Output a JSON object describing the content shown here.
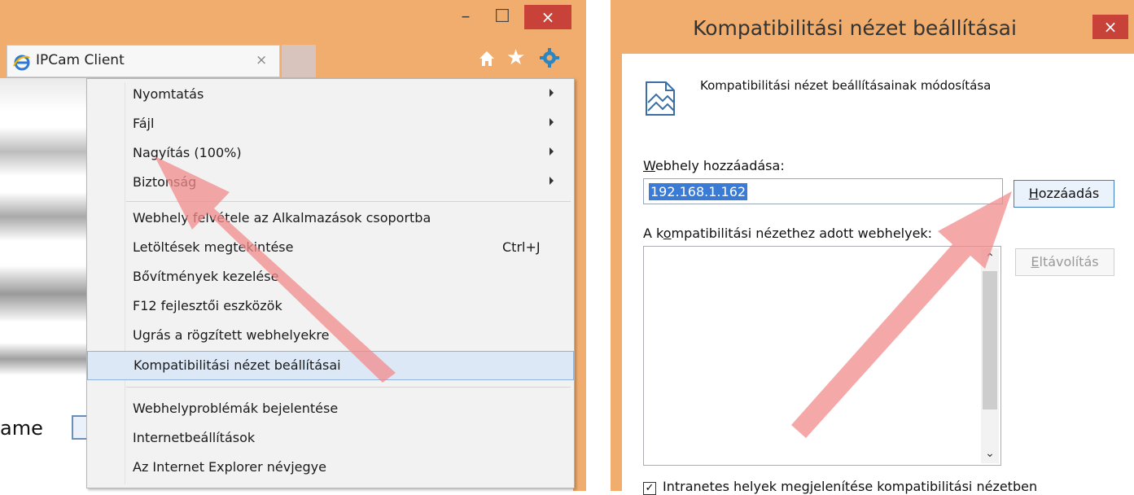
{
  "ie": {
    "tab_title": "IPCam Client",
    "tab_close": "×",
    "window_close": "×",
    "page_label": "ame"
  },
  "menu": {
    "items": [
      {
        "label": "Nyomtatás",
        "submenu": true
      },
      {
        "label": "Fájl",
        "submenu": true
      },
      {
        "label": "Nagyítás (100%)",
        "submenu": true
      },
      {
        "label": "Biztonság",
        "submenu": true
      },
      {
        "label": "Webhely felvétele az Alkalmazások csoportba"
      },
      {
        "label": "Letöltések megtekintése",
        "shortcut": "Ctrl+J"
      },
      {
        "label": "Bővítmények kezelése"
      },
      {
        "label": "F12 fejlesztői eszközök"
      },
      {
        "label": "Ugrás a rögzített webhelyekre"
      },
      {
        "label": "Kompatibilitási nézet beállításai",
        "highlighted": true
      },
      {
        "label": "Webhelyproblémák bejelentése"
      },
      {
        "label": "Internetbeállítások"
      },
      {
        "label": "Az Internet Explorer névjegye"
      }
    ]
  },
  "dialog": {
    "title": "Kompatibilitási nézet beállításai",
    "close": "×",
    "heading": "Kompatibilitási nézet beállításainak módosítása",
    "add_label_access": "W",
    "add_label_rest": "ebhely hozzáadása:",
    "add_value": "192.168.1.162",
    "add_button_access": "H",
    "add_button_rest": "ozzáadás",
    "list_label_pre": "A k",
    "list_label_access": "o",
    "list_label_rest": "mpatibilitási nézethez adott webhelyek:",
    "remove_button_access": "E",
    "remove_button_rest": "ltávolítás",
    "intranet_label": "Intranetes helyek megjelenítése kompatibilitási nézetben",
    "intranet_checked": "✓"
  },
  "colors": {
    "title_bar": "#f0ad6d",
    "close_button": "#c9423a",
    "highlight": "#dce8f6",
    "annotation_arrow": "#f28b8b"
  }
}
